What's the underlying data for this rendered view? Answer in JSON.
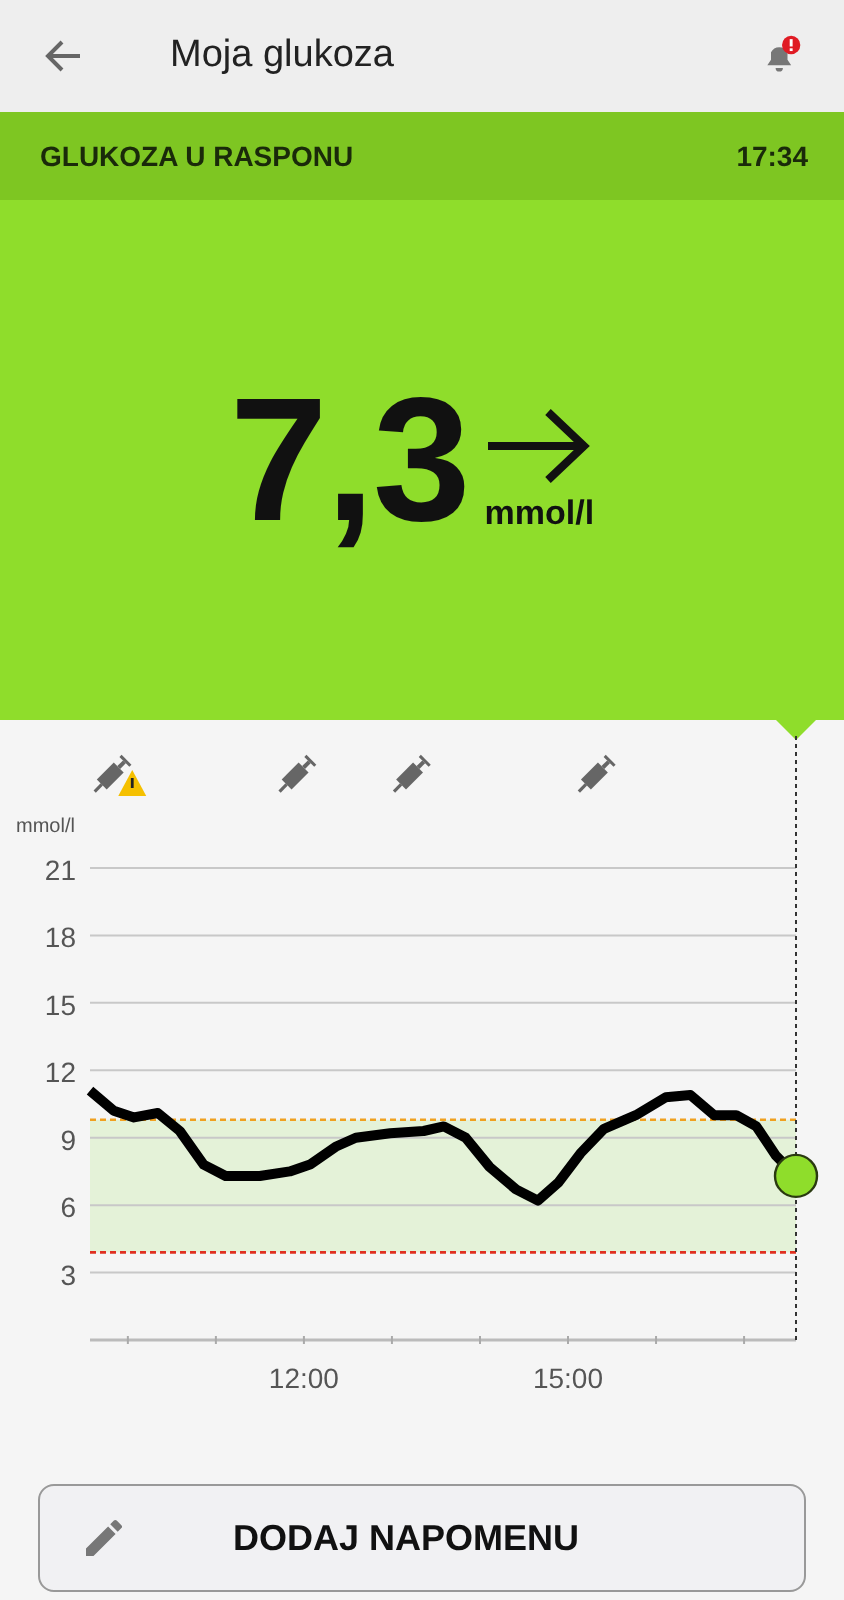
{
  "header": {
    "title": "Moja glukoza",
    "notification_alert": true
  },
  "status": {
    "label": "GLUKOZA U RASPONU",
    "time": "17:34"
  },
  "reading": {
    "value": "7,3",
    "unit": "mmol/l"
  },
  "chart": {
    "unit_label": "mmol/l",
    "insulin_markers": [
      {
        "warning": true
      },
      {
        "warning": false
      },
      {
        "warning": false
      },
      {
        "warning": false
      }
    ],
    "chart_data": {
      "type": "line",
      "xlim": [
        9.57,
        17.59
      ],
      "ylim": [
        0,
        21
      ],
      "grid": true,
      "yticks": [
        3,
        6,
        9,
        12,
        15,
        18,
        21
      ],
      "xticks": [
        {
          "value": 12,
          "label": "12:00"
        },
        {
          "value": 15,
          "label": "15:00"
        }
      ],
      "x": [
        9.57,
        9.84,
        10.07,
        10.34,
        10.59,
        10.86,
        11.11,
        11.5,
        11.84,
        12.07,
        12.36,
        12.59,
        12.98,
        13.36,
        13.59,
        13.84,
        14.11,
        14.41,
        14.66,
        14.89,
        15.14,
        15.41,
        15.77,
        16.11,
        16.39,
        16.66,
        16.91,
        17.14,
        17.36,
        17.59
      ],
      "series": [
        {
          "color": "#000000",
          "values": [
            11.1,
            10.2,
            9.9,
            10.1,
            9.3,
            7.8,
            7.3,
            7.3,
            7.5,
            7.8,
            8.6,
            9.0,
            9.2,
            9.3,
            9.5,
            9.0,
            7.7,
            6.7,
            6.2,
            7.0,
            8.3,
            9.4,
            10.0,
            10.8,
            10.9,
            10.0,
            10.0,
            9.5,
            8.2,
            7.3
          ]
        }
      ],
      "bands": [
        {
          "axis": "y",
          "from": 3.9,
          "to": 9.8,
          "color": "#e4f2d8"
        }
      ],
      "ref_lines": [
        {
          "axis": "y",
          "value": 9.8,
          "color": "#f0a020"
        },
        {
          "axis": "y",
          "value": 3.9,
          "color": "#e03020"
        }
      ]
    }
  },
  "add_note_button": {
    "label": "DODAJ NAPOMENU"
  }
}
